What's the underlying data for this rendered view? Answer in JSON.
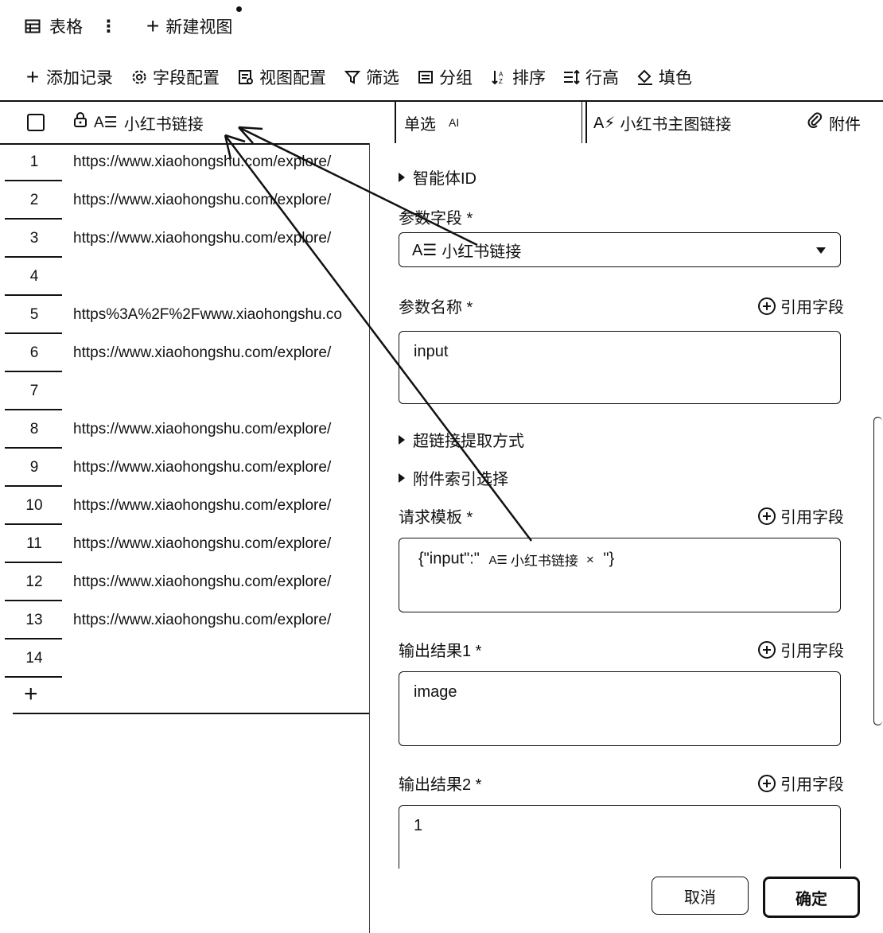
{
  "topbar": {
    "view_name": "表格",
    "more_icon": "more-vertical-icon",
    "new_view_label": "新建视图"
  },
  "toolbar": {
    "items": [
      {
        "icon": "plus-icon",
        "label": "添加记录"
      },
      {
        "icon": "gear-icon",
        "label": "字段配置"
      },
      {
        "icon": "view-config-icon",
        "label": "视图配置"
      },
      {
        "icon": "filter-icon",
        "label": "筛选"
      },
      {
        "icon": "group-icon",
        "label": "分组"
      },
      {
        "icon": "sort-icon",
        "label": "排序"
      },
      {
        "icon": "row-height-icon",
        "label": "行高"
      },
      {
        "icon": "fill-color-icon",
        "label": "填色"
      }
    ]
  },
  "columns": {
    "col1": "小红书链接",
    "col2": "单选",
    "col2_badge": "AI",
    "col3": "小红书主图链接",
    "col4": "附件"
  },
  "rows": [
    {
      "num": "1",
      "url": "https://www.xiaohongshu.com/explore/"
    },
    {
      "num": "2",
      "url": "https://www.xiaohongshu.com/explore/"
    },
    {
      "num": "3",
      "url": "https://www.xiaohongshu.com/explore/"
    },
    {
      "num": "4",
      "url": ""
    },
    {
      "num": "5",
      "url": "https%3A%2F%2Fwww.xiaohongshu.co"
    },
    {
      "num": "6",
      "url": "https://www.xiaohongshu.com/explore/"
    },
    {
      "num": "7",
      "url": ""
    },
    {
      "num": "8",
      "url": "https://www.xiaohongshu.com/explore/"
    },
    {
      "num": "9",
      "url": "https://www.xiaohongshu.com/explore/"
    },
    {
      "num": "10",
      "url": "https://www.xiaohongshu.com/explore/"
    },
    {
      "num": "11",
      "url": "https://www.xiaohongshu.com/explore/"
    },
    {
      "num": "12",
      "url": "https://www.xiaohongshu.com/explore/"
    },
    {
      "num": "13",
      "url": "https://www.xiaohongshu.com/explore/"
    },
    {
      "num": "14",
      "url": ""
    }
  ],
  "add_row_symbol": "+",
  "panel": {
    "agent_id_label": "智能体ID",
    "param_field_label": "参数字段 *",
    "param_field_value": "小红书链接",
    "param_name_label": "参数名称 *",
    "param_name_value": "input",
    "cite_label": "引用字段",
    "link_extract_label": "超链接提取方式",
    "attach_index_label": "附件索引选择",
    "request_template_label": "请求模板 *",
    "template_prefix": "{\"input\":\"",
    "template_tag": "小红书链接",
    "template_tag_close": "×",
    "template_suffix": "\"}",
    "output1_label": "输出结果1 *",
    "output1_value": "image",
    "output2_label": "输出结果2 *",
    "output2_value": "1",
    "cancel": "取消",
    "confirm": "确定"
  },
  "text_icon_glyph": "A☰"
}
